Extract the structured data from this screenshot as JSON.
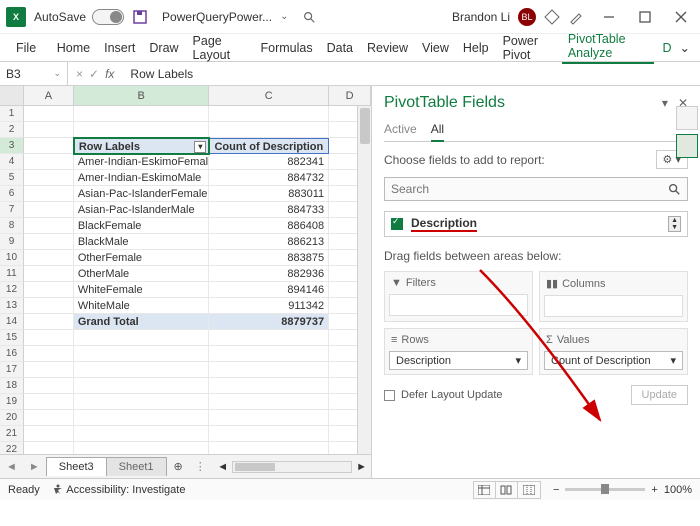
{
  "titlebar": {
    "autosave_label": "AutoSave",
    "autosave_state": "Off",
    "filename": "PowerQueryPower...",
    "user_name": "Brandon Li",
    "user_initials": "BL"
  },
  "ribbon": {
    "tabs": [
      "File",
      "Home",
      "Insert",
      "Draw",
      "Page Layout",
      "Formulas",
      "Data",
      "Review",
      "View",
      "Help",
      "Power Pivot",
      "PivotTable Analyze",
      "D"
    ],
    "active_index": 11
  },
  "formula_bar": {
    "namebox": "B3",
    "fx": "fx",
    "value": "Row Labels"
  },
  "grid": {
    "columns": [
      "A",
      "B",
      "C",
      "D"
    ],
    "selected_col": "B",
    "selected_row": 3,
    "row_count": 24,
    "pivot_headers": {
      "row_label": "Row Labels",
      "data_label": "Count of Description"
    },
    "pivot_rows": [
      {
        "label": "Amer-Indian-EskimoFemale",
        "value": "882341"
      },
      {
        "label": "Amer-Indian-EskimoMale",
        "value": "884732"
      },
      {
        "label": "Asian-Pac-IslanderFemale",
        "value": "883011"
      },
      {
        "label": "Asian-Pac-IslanderMale",
        "value": "884733"
      },
      {
        "label": "BlackFemale",
        "value": "886408"
      },
      {
        "label": "BlackMale",
        "value": "886213"
      },
      {
        "label": "OtherFemale",
        "value": "883875"
      },
      {
        "label": "OtherMale",
        "value": "882936"
      },
      {
        "label": "WhiteFemale",
        "value": "894146"
      },
      {
        "label": "WhiteMale",
        "value": "911342"
      }
    ],
    "grand_total": {
      "label": "Grand Total",
      "value": "8879737"
    }
  },
  "sheets": {
    "tabs": [
      "Sheet3",
      "Sheet1"
    ],
    "active": 0
  },
  "pane": {
    "title": "PivotTable Fields",
    "tab_active": "Active",
    "tab_all": "All",
    "choose_label": "Choose fields to add to report:",
    "search_placeholder": "Search",
    "field_name": "Description",
    "drag_hint": "Drag fields between areas below:",
    "areas": {
      "filters": "Filters",
      "columns": "Columns",
      "rows": "Rows",
      "values": "Values",
      "rows_item": "Description",
      "values_item": "Count of Description"
    },
    "defer_label": "Defer Layout Update",
    "update_label": "Update"
  },
  "statusbar": {
    "ready": "Ready",
    "accessibility": "Accessibility: Investigate",
    "zoom": "100%"
  }
}
